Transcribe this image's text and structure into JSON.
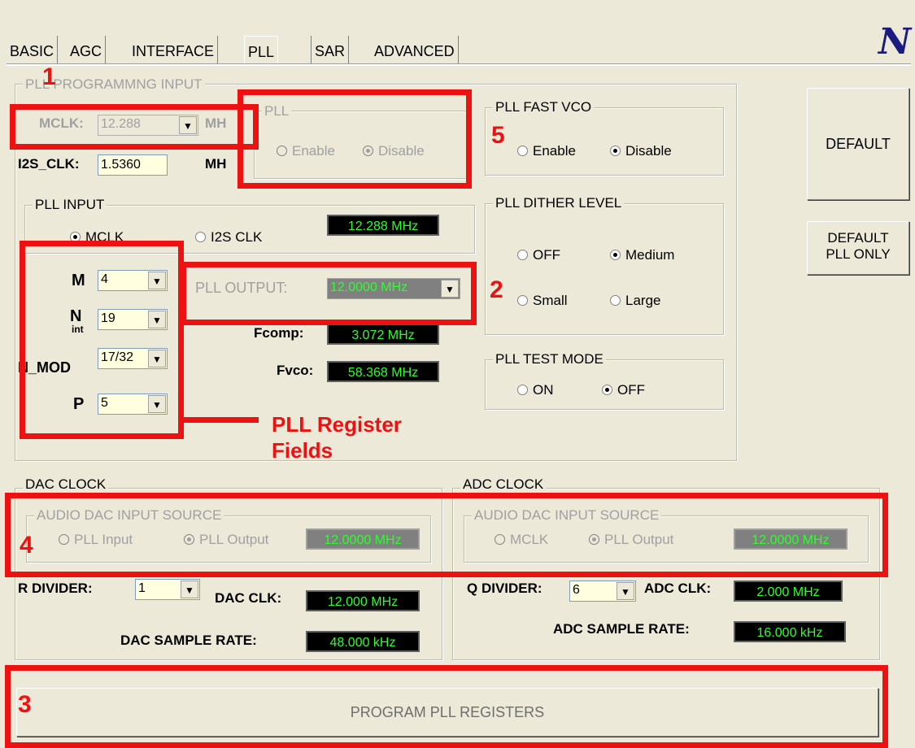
{
  "tabs": [
    "BASIC",
    "AGC",
    "INTERFACE",
    "PLL",
    "SAR",
    "ADVANCED"
  ],
  "pll_prog": {
    "title": "PLL PROGRAMMNG INPUT",
    "mclk_label": "MCLK:",
    "mclk_value": "12.288",
    "mclk_unit": "MH",
    "i2s_label": "I2S_CLK:",
    "i2s_value": "1.5360",
    "i2s_unit": "MH"
  },
  "pll_box": {
    "title": "PLL",
    "enable": "Enable",
    "disable": "Disable",
    "selected": "Disable"
  },
  "pll_fast_vco": {
    "title": "PLL FAST VCO",
    "enable": "Enable",
    "disable": "Disable",
    "selected": "Disable"
  },
  "pll_input": {
    "title": "PLL INPUT",
    "mclk": "MCLK",
    "i2s": "I2S CLK",
    "selected": "MCLK",
    "freq": "12.288 MHz"
  },
  "registers": {
    "m_label": "M",
    "m_value": "4",
    "n_label": "N",
    "n_sub": "int",
    "n_value": "19",
    "nmod_label": "N_MOD",
    "nmod_value": "17/32",
    "p_label": "P",
    "p_value": "5"
  },
  "pll_output": {
    "label": "PLL OUTPUT:",
    "value": "12.0000 MHz"
  },
  "fcomp": {
    "label": "Fcomp:",
    "value": "3.072 MHz"
  },
  "fvco": {
    "label": "Fvco:",
    "value": "58.368 MHz"
  },
  "dither": {
    "title": "PLL DITHER LEVEL",
    "off": "OFF",
    "medium": "Medium",
    "small": "Small",
    "large": "Large",
    "selected": "Medium"
  },
  "test_mode": {
    "title": "PLL TEST MODE",
    "on": "ON",
    "off": "OFF",
    "selected": "OFF"
  },
  "buttons": {
    "default": "DEFAULT",
    "default_pll_line1": "DEFAULT",
    "default_pll_line2": "PLL ONLY",
    "program": "PROGRAM PLL REGISTERS"
  },
  "dac_clock": {
    "title": "DAC CLOCK",
    "source_title": "AUDIO DAC INPUT SOURCE",
    "opt1": "PLL Input",
    "opt2": "PLL Output",
    "selected": "PLL Output",
    "source_freq": "12.0000 MHz",
    "r_label": "R DIVIDER:",
    "r_value": "1",
    "clk_label": "DAC CLK:",
    "clk_value": "12.000 MHz",
    "rate_label": "DAC SAMPLE RATE:",
    "rate_value": "48.000 kHz"
  },
  "adc_clock": {
    "title": "ADC CLOCK",
    "source_title": "AUDIO DAC INPUT SOURCE",
    "opt1": "MCLK",
    "opt2": "PLL Output",
    "selected": "PLL Output",
    "source_freq": "12.0000 MHz",
    "q_label": "Q DIVIDER:",
    "q_value": "6",
    "clk_label": "ADC CLK:",
    "clk_value": "2.000 MHz",
    "rate_label": "ADC SAMPLE RATE:",
    "rate_value": "16.000 kHz"
  },
  "annotations": {
    "n1": "1",
    "n2": "2",
    "n3": "3",
    "n4": "4",
    "n5": "5",
    "fields_line1": "PLL Register",
    "fields_line2": "Fields",
    "color": "#ee1111"
  },
  "icons": {
    "logo": "national-semiconductor-logo",
    "dropdown": "chevron-down-icon"
  }
}
